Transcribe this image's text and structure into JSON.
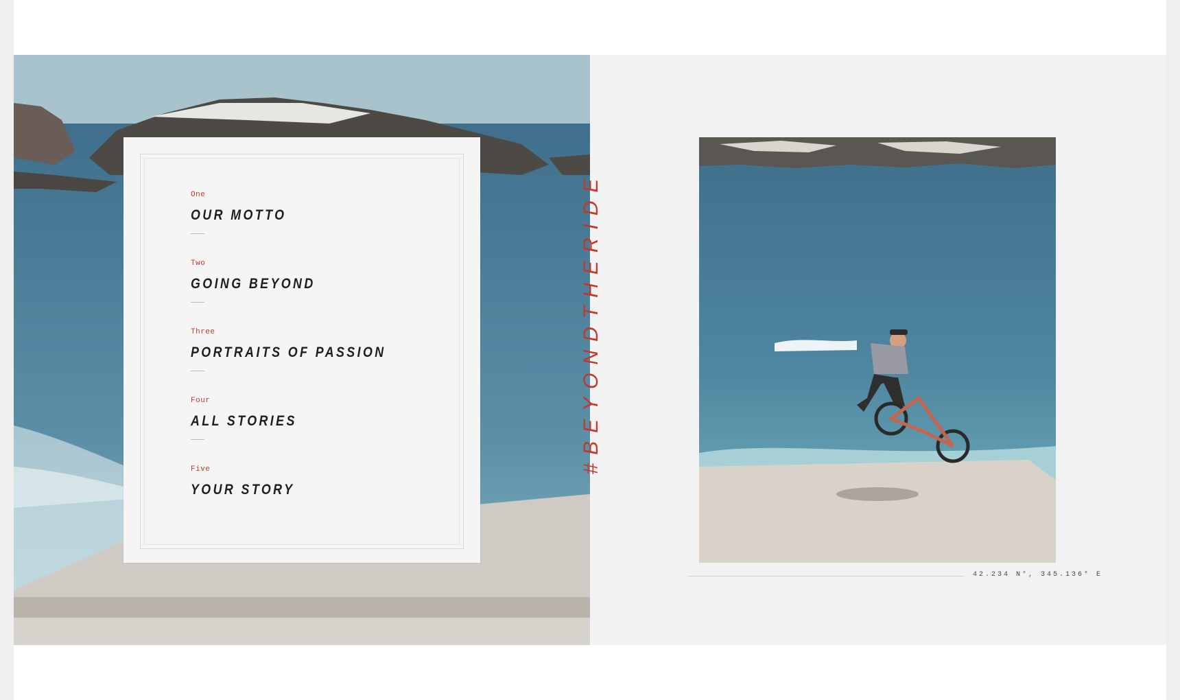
{
  "menu": {
    "items": [
      {
        "number": "One",
        "label": "OUR MOTTO"
      },
      {
        "number": "Two",
        "label": "GOING BEYOND"
      },
      {
        "number": "Three",
        "label": "PORTRAITS OF PASSION"
      },
      {
        "number": "Four",
        "label": "ALL STORIES"
      },
      {
        "number": "Five",
        "label": "YOUR STORY"
      }
    ]
  },
  "hashtag": "#BEYONDTHERIDE",
  "photo_caption": {
    "coordinates": "42.234 N°, 345.136° E"
  },
  "colors": {
    "accent": "#c0392b",
    "text": "#1e1e1e",
    "card_background": "#f5f5f5",
    "panel_background": "#f2f2f2"
  },
  "images": {
    "left": "coastal-rocks-and-ocean-photo",
    "right": "bmx-rider-jumping-over-ocean-photo"
  }
}
